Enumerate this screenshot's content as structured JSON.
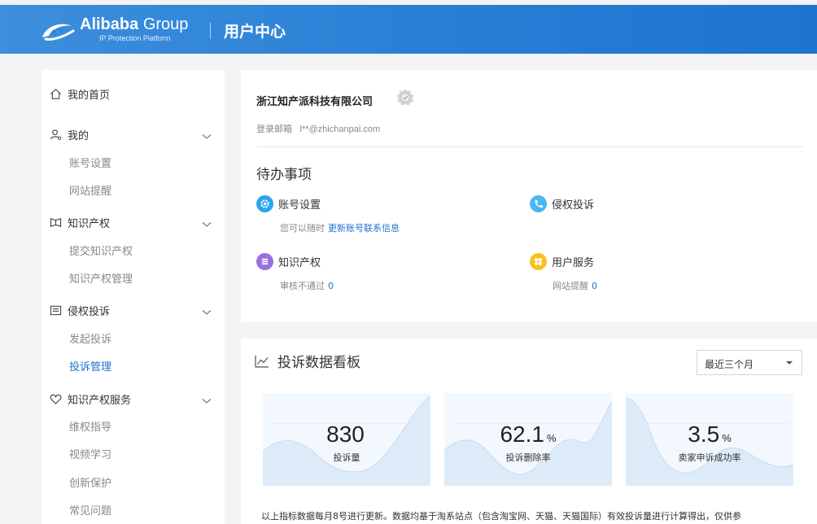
{
  "brand": {
    "name_bold": "Alibaba",
    "name_light": "Group",
    "subtitle": "IP Protection Platform",
    "page_title": "用户中心",
    "logo_icon": "alibaba-logo-icon",
    "accent_color": "#2a80d6"
  },
  "sidebar": {
    "home": {
      "label": "我的首页",
      "icon": "home-icon"
    },
    "groups": [
      {
        "label": "我的",
        "icon": "user-icon",
        "items": [
          "账号设置",
          "网站提醒"
        ]
      },
      {
        "label": "知识产权",
        "icon": "book-icon",
        "items": [
          "提交知识产权",
          "知识产权管理"
        ]
      },
      {
        "label": "侵权投诉",
        "icon": "complaint-icon",
        "items": [
          "发起投诉",
          "投诉管理"
        ],
        "active_item": "投诉管理"
      },
      {
        "label": "知识产权服务",
        "icon": "heart-icon",
        "items": [
          "维权指导",
          "视频学习",
          "创新保护",
          "常见问题"
        ]
      }
    ]
  },
  "account": {
    "company": "浙江知产派科技有限公司",
    "badge_icon": "verified-badge-icon",
    "email_label": "登录邮箱",
    "email_value": "l**@zhichanpai.com"
  },
  "todo": {
    "title": "待办事项",
    "items": [
      {
        "label": "账号设置",
        "icon": "gear-icon",
        "color": "#2aa3f0",
        "note": "您可以随时",
        "link": "更新账号联系信息"
      },
      {
        "label": "侵权投诉",
        "icon": "phone-icon",
        "color": "#4ab6f2",
        "note": "",
        "link": ""
      },
      {
        "label": "知识产权",
        "icon": "list-icon",
        "color": "#9b6ee3",
        "note": "审核不通过",
        "link": "0"
      },
      {
        "label": "用户服务",
        "icon": "clover-icon",
        "color": "#f7c21d",
        "note": "网站提醒",
        "link": "0"
      }
    ]
  },
  "board": {
    "title": "投诉数据看板",
    "icon": "line-chart-icon",
    "period": "最近三个月",
    "stats": [
      {
        "value": "830",
        "unit": "",
        "label": "投诉量"
      },
      {
        "value": "62.1",
        "unit": "%",
        "label": "投诉删除率"
      },
      {
        "value": "3.5",
        "unit": "%",
        "label": "卖家申诉成功率"
      }
    ],
    "footnote": "以上指标数据每月8号进行更新。数据均基于淘系站点（包含淘宝网、天猫、天猫国际）有效投诉量进行计算得出，仅供参"
  }
}
